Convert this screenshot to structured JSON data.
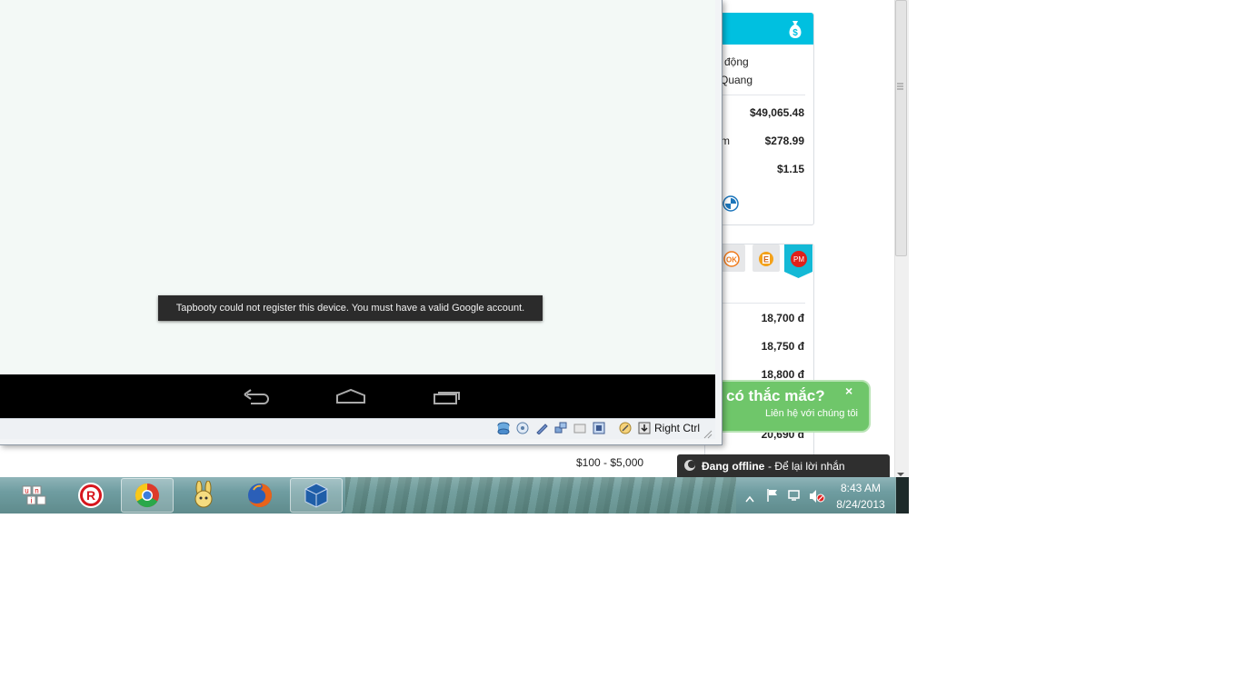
{
  "browser_page": {
    "card1": {
      "line1": "động",
      "line2": "Quang",
      "rows": [
        {
          "label": "",
          "value": "$49,065.48"
        },
        {
          "label": "m",
          "value": "$278.99"
        },
        {
          "label": "",
          "value": "$1.15"
        }
      ]
    },
    "card2": {
      "tabs": [
        {
          "icon": "ok-icon",
          "text": "OK"
        },
        {
          "icon": "e-icon",
          "text": "E"
        },
        {
          "icon": "pm-icon",
          "text": "PM"
        }
      ],
      "prices": [
        "18,700 đ",
        "18,750 đ",
        "18,800 đ",
        "20,690 đ"
      ]
    },
    "range_label": "$100 - $5,000",
    "help_bubble": {
      "title": "có thắc mắc?",
      "subtitle": "Liên hệ với chúng tôi",
      "close": "×"
    },
    "offline_bar": {
      "status": "Đang offline",
      "action": "- Để lại lời nhắn"
    }
  },
  "vbox": {
    "toast": "Tapbooty could not register this device. You must have a valid Google account.",
    "host_key": "Right Ctrl",
    "nav_buttons": [
      "back",
      "home",
      "recent-apps"
    ]
  },
  "taskbar": {
    "apps": [
      {
        "name": "unikey",
        "open": false
      },
      {
        "name": "r-app",
        "open": false
      },
      {
        "name": "chrome",
        "open": true
      },
      {
        "name": "bunny-app",
        "open": false
      },
      {
        "name": "firefox",
        "open": false
      },
      {
        "name": "virtualbox",
        "open": true
      }
    ],
    "clock": {
      "time": "8:43 AM",
      "date": "8/24/2013"
    }
  },
  "colors": {
    "accent_cyan": "#00c0e0",
    "help_green": "#6fc66a",
    "pm_red": "#e0201a"
  }
}
